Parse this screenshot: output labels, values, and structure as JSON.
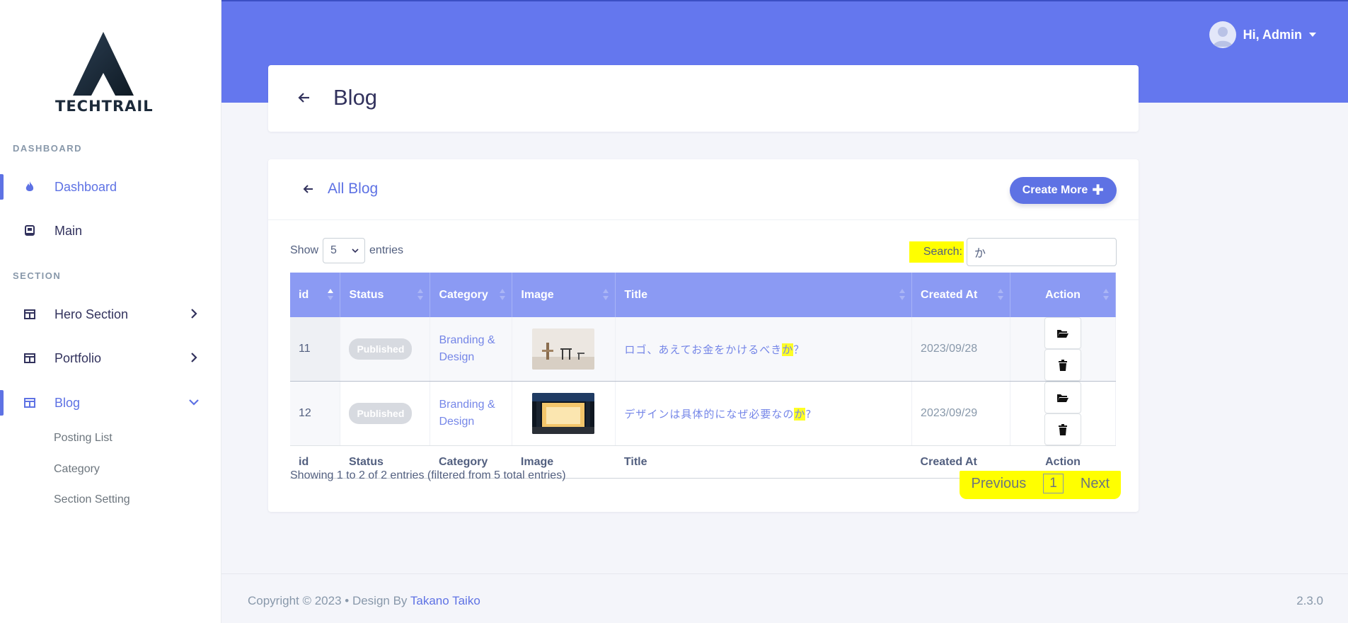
{
  "brand": {
    "name": "TECHTRAIL"
  },
  "sidebar": {
    "heading_dashboard": "DASHBOARD",
    "heading_section": "SECTION",
    "items": [
      {
        "label": "Dashboard",
        "icon": "flame-icon"
      },
      {
        "label": "Main",
        "icon": "book-icon"
      },
      {
        "label": "Hero Section",
        "icon": "layout-icon"
      },
      {
        "label": "Portfolio",
        "icon": "layout-icon"
      },
      {
        "label": "Blog",
        "icon": "layout-icon"
      }
    ],
    "blog_sub": [
      "Posting List",
      "Category",
      "Section Setting"
    ]
  },
  "header": {
    "user_greeting": "Hi, Admin"
  },
  "page": {
    "title": "Blog"
  },
  "card": {
    "title": "All Blog",
    "create_label": "Create More",
    "show_label": "Show",
    "entries_label": "entries",
    "page_size": "5",
    "search_label": "Search:",
    "search_value": "か"
  },
  "table": {
    "columns": [
      "id",
      "Status",
      "Category",
      "Image",
      "Title",
      "Created At",
      "Action"
    ],
    "rows": [
      {
        "id": "11",
        "status": "Published",
        "category": "Branding & Design",
        "title_pre": "ロゴ、あえてお金をかけるべき",
        "title_hl": "か",
        "title_post": "？",
        "created": "2023/09/28"
      },
      {
        "id": "12",
        "status": "Published",
        "category": "Branding & Design",
        "title_pre": "デザインは具体的になぜ必要なの",
        "title_hl": "か",
        "title_post": "?",
        "created": "2023/09/29"
      }
    ]
  },
  "pagination": {
    "info": "Showing 1 to 2 of 2 entries (filtered from 5 total entries)",
    "prev": "Previous",
    "page": "1",
    "next": "Next"
  },
  "footer": {
    "copyright": "Copyright © 2023  •  Design By",
    "designer": "Takano Taiko",
    "version": "2.3.0"
  },
  "colors": {
    "accent": "#5e72e4",
    "header": "#6477ee",
    "highlight": "#ffff00"
  }
}
